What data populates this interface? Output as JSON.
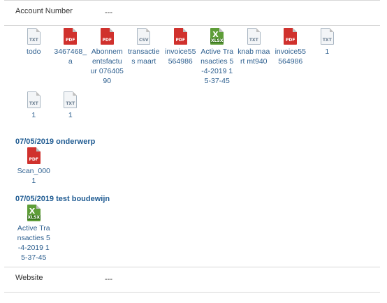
{
  "account": {
    "label": "Account Number",
    "value": "---"
  },
  "files": [
    {
      "type": "TXT",
      "name": "todo"
    },
    {
      "type": "PDF",
      "name": "3467468_a"
    },
    {
      "type": "PDF",
      "name": "Abonnementsfactuur 07640590"
    },
    {
      "type": "CSV",
      "name": "transacties maart"
    },
    {
      "type": "PDF",
      "name": "invoice55564986"
    },
    {
      "type": "XLSX",
      "name": "Active Transacties 5-4-2019 15-37-45"
    },
    {
      "type": "TXT",
      "name": "knab maart mt940"
    },
    {
      "type": "PDF",
      "name": "invoice55564986"
    },
    {
      "type": "TXT",
      "name": "1"
    },
    {
      "type": "TXT",
      "name": "1"
    },
    {
      "type": "TXT",
      "name": "1"
    }
  ],
  "messages": [
    {
      "title": "07/05/2019 onderwerp",
      "files": [
        {
          "type": "PDF",
          "name": "Scan_0001"
        }
      ]
    },
    {
      "title": "07/05/2019 test boudewijn",
      "files": [
        {
          "type": "XLSX",
          "name": "Active Transacties 5-4-2019 15-37-45"
        }
      ]
    }
  ],
  "website": {
    "label": "Website",
    "value": "---"
  },
  "colors": {
    "pdf": "#d0312d",
    "xlsx": "#5e9d38",
    "link": "#2d5f8f",
    "heading": "#1f5b92"
  }
}
